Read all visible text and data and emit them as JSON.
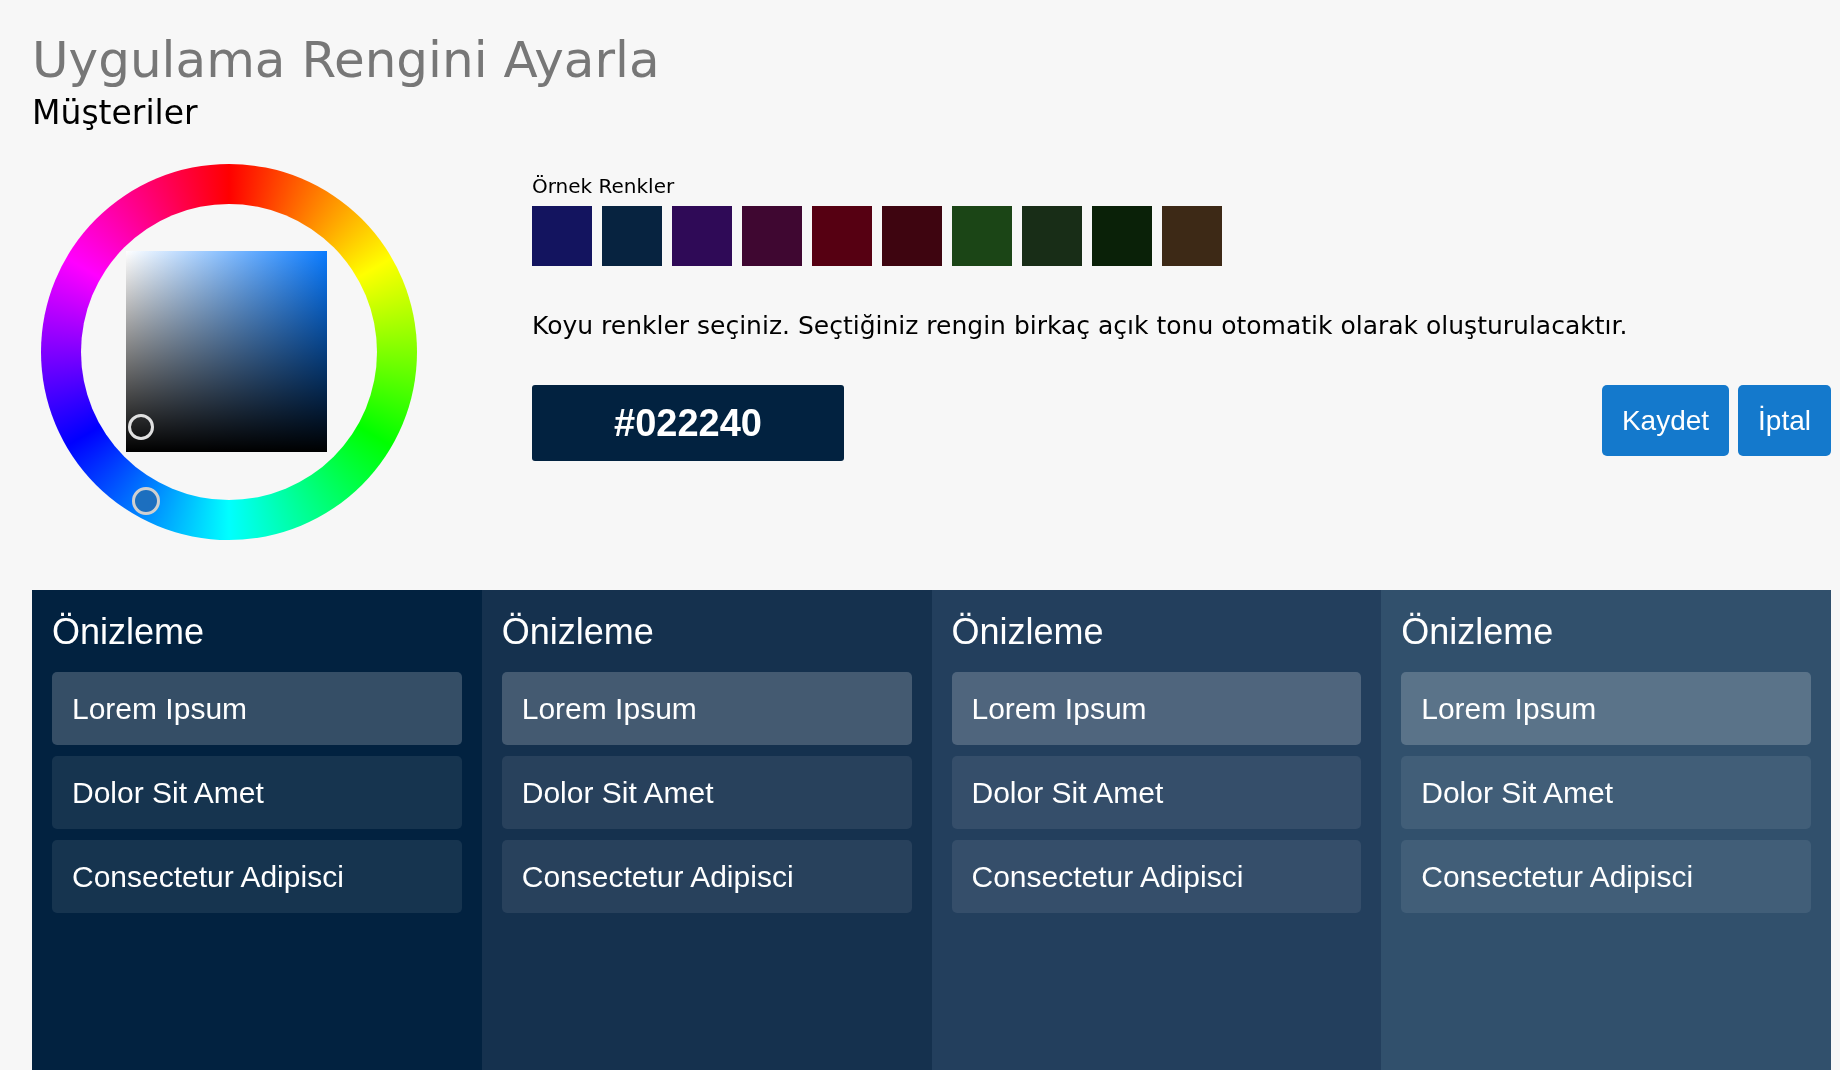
{
  "title": "Uygulama Rengini Ayarla",
  "subtitle": "Müşteriler",
  "samples": {
    "label": "Örnek Renkler",
    "swatches": [
      {
        "color": "#13145f"
      },
      {
        "color": "#072340"
      },
      {
        "color": "#2f0a57"
      },
      {
        "color": "#3f0731"
      },
      {
        "color": "#560012"
      },
      {
        "color": "#3e0510"
      },
      {
        "color": "#1b4516"
      },
      {
        "color": "#182d17"
      },
      {
        "color": "#0a2108"
      },
      {
        "color": "#3d2916"
      }
    ]
  },
  "hint": "Koyu renkler seçiniz. Seçtiğiniz rengin birkaç açık tonu otomatik olarak oluşturulacaktır.",
  "hex_value": "#022240",
  "buttons": [
    "Kaydet",
    "İptal"
  ],
  "previews": [
    {
      "color": "#022240",
      "heading": "Önizleme",
      "items": [
        {
          "label": "Lorem Ipsum",
          "selected": true
        },
        {
          "label": "Dolor Sit Amet",
          "selected": false
        },
        {
          "label": "Consectetur Adipisci",
          "selected": false
        }
      ]
    },
    {
      "color": "#15314e",
      "heading": "Önizleme",
      "items": [
        {
          "label": "Lorem Ipsum",
          "selected": true
        },
        {
          "label": "Dolor Sit Amet",
          "selected": false
        },
        {
          "label": "Consectetur Adipisci",
          "selected": false
        }
      ]
    },
    {
      "color": "#233f5d",
      "heading": "Önizleme",
      "items": [
        {
          "label": "Lorem Ipsum",
          "selected": true
        },
        {
          "label": "Dolor Sit Amet",
          "selected": false
        },
        {
          "label": "Consectetur Adipisci",
          "selected": false
        }
      ]
    },
    {
      "color": "#31506c",
      "heading": "Önizleme",
      "items": [
        {
          "label": "Lorem Ipsum",
          "selected": true
        },
        {
          "label": "Dolor Sit Amet",
          "selected": false
        },
        {
          "label": "Consectetur Adipisci",
          "selected": false
        }
      ]
    }
  ]
}
